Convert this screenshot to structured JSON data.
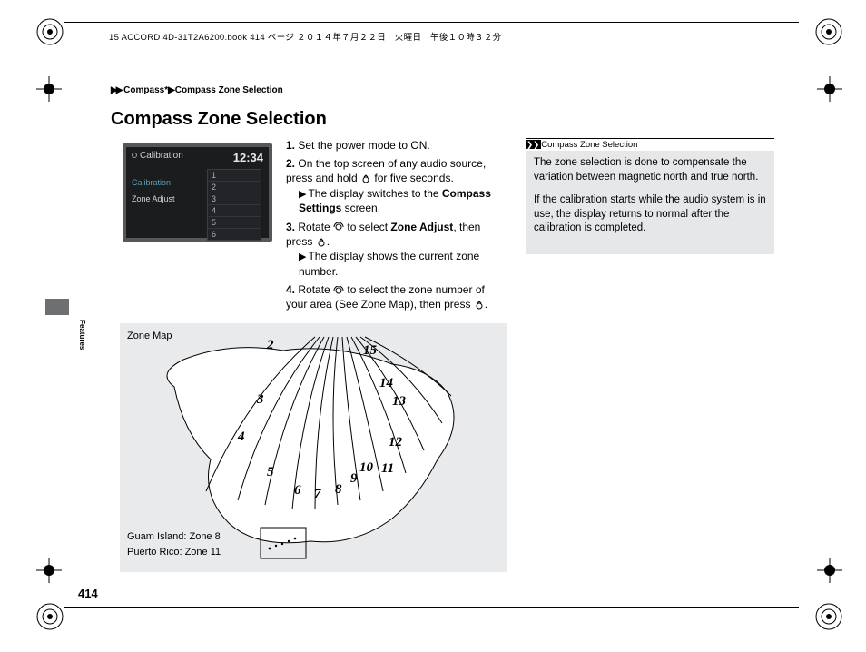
{
  "header_line_text": "15 ACCORD 4D-31T2A6200.book  414 ページ  ２０１４年７月２２日　火曜日　午後１０時３２分",
  "breadcrumb": {
    "arrow": "▶▶",
    "part1": "Compass",
    "star": "*",
    "sep": "▶",
    "part2": "Compass Zone Selection"
  },
  "title": "Compass Zone Selection",
  "screen": {
    "top_label": "Calibration",
    "time": "12:34",
    "menu_calibration": "Calibration",
    "menu_zone_adjust": "Zone Adjust",
    "list": [
      "1",
      "2",
      "3",
      "4",
      "5",
      "6"
    ]
  },
  "steps": {
    "s1_num": "1.",
    "s1": "Set the power mode to ON.",
    "s2_num": "2.",
    "s2a": "On the top screen of any audio source, press and hold ",
    "s2b": " for five seconds.",
    "s2_sub_pre": "The display switches to the ",
    "s2_sub_bold": "Compass Settings",
    "s2_sub_post": " screen.",
    "s3_num": "3.",
    "s3a": "Rotate ",
    "s3b": " to select ",
    "s3_bold": "Zone Adjust",
    "s3c": ", then press ",
    "s3d": ".",
    "s3_sub": "The display shows the current zone number.",
    "s4_num": "4.",
    "s4a": "Rotate ",
    "s4b": " to select the zone number of your area (See Zone Map), then press ",
    "s4c": "."
  },
  "info": {
    "head_icon": "❯❯",
    "head": "Compass Zone Selection",
    "p1": "The zone selection is done to compensate the variation between magnetic north and true north.",
    "p2": "If the calibration starts while the audio system is in use, the display returns to normal after the calibration is completed."
  },
  "side_tab": "Features",
  "map": {
    "title": "Zone Map",
    "guam": "Guam Island: Zone 8",
    "pr": "Puerto Rico: Zone 11"
  },
  "zones": {
    "z2": "2",
    "z3": "3",
    "z4": "4",
    "z5": "5",
    "z6": "6",
    "z7": "7",
    "z8": "8",
    "z9": "9",
    "z10": "10",
    "z11": "11",
    "z12": "12",
    "z13": "13",
    "z14": "14",
    "z15": "15"
  },
  "page_number": "414"
}
